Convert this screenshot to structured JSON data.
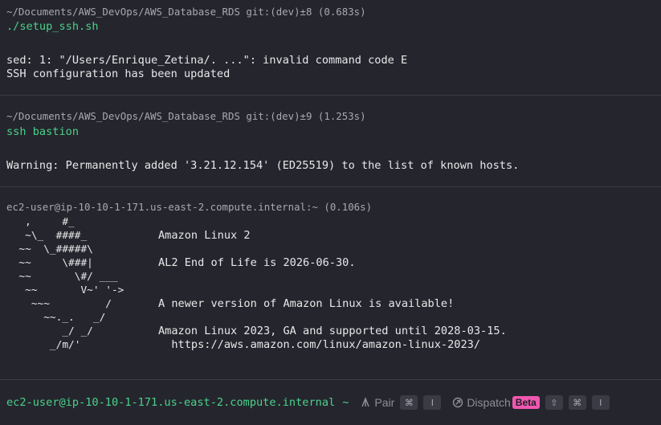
{
  "blocks": [
    {
      "header": "~/Documents/AWS_DevOps/AWS_Database_RDS git:(dev)±8 (0.683s)",
      "command": "./setup_ssh.sh",
      "output": [
        "sed: 1: \"/Users/Enrique_Zetina/. ...\": invalid command code E",
        "SSH configuration has been updated"
      ]
    },
    {
      "header": "~/Documents/AWS_DevOps/AWS_Database_RDS git:(dev)±9 (1.253s)",
      "command": "ssh bastion",
      "output": [
        "Warning: Permanently added '3.21.12.154' (ED25519) to the list of known hosts."
      ]
    },
    {
      "header": "ec2-user@ip-10-10-1-171.us-east-2.compute.internal:~ (0.106s)",
      "art": "   ,     #_\n   ~\\_  ####_\n  ~~  \\_#####\\\n  ~~     \\###|\n  ~~       \\#/ ___\n   ~~       V~' '->\n    ~~~         /\n      ~~._.   _/\n         _/ _/\n       _/m/'",
      "messages": {
        "distro": "Amazon Linux 2",
        "eol": "AL2 End of Life is 2026-06-30.",
        "newer": "A newer version of Amazon Linux is available!",
        "al2023": "Amazon Linux 2023, GA and supported until 2028-03-15.",
        "url": "  https://aws.amazon.com/linux/amazon-linux-2023/"
      }
    }
  ],
  "prompt": {
    "text": "ec2-user@ip-10-10-1-171.us-east-2.compute.internal",
    "tilde": "~",
    "pair_label": "Pair",
    "pair_keys": [
      "⌘",
      "I"
    ],
    "dispatch_label": "Dispatch",
    "dispatch_badge": "Beta",
    "dispatch_keys": [
      "⇧",
      "⌘",
      "I"
    ]
  },
  "colors": {
    "background": "#25262d",
    "command": "#4ad18a",
    "header": "#a7a8b1",
    "beta_badge": "#ef58b0"
  }
}
